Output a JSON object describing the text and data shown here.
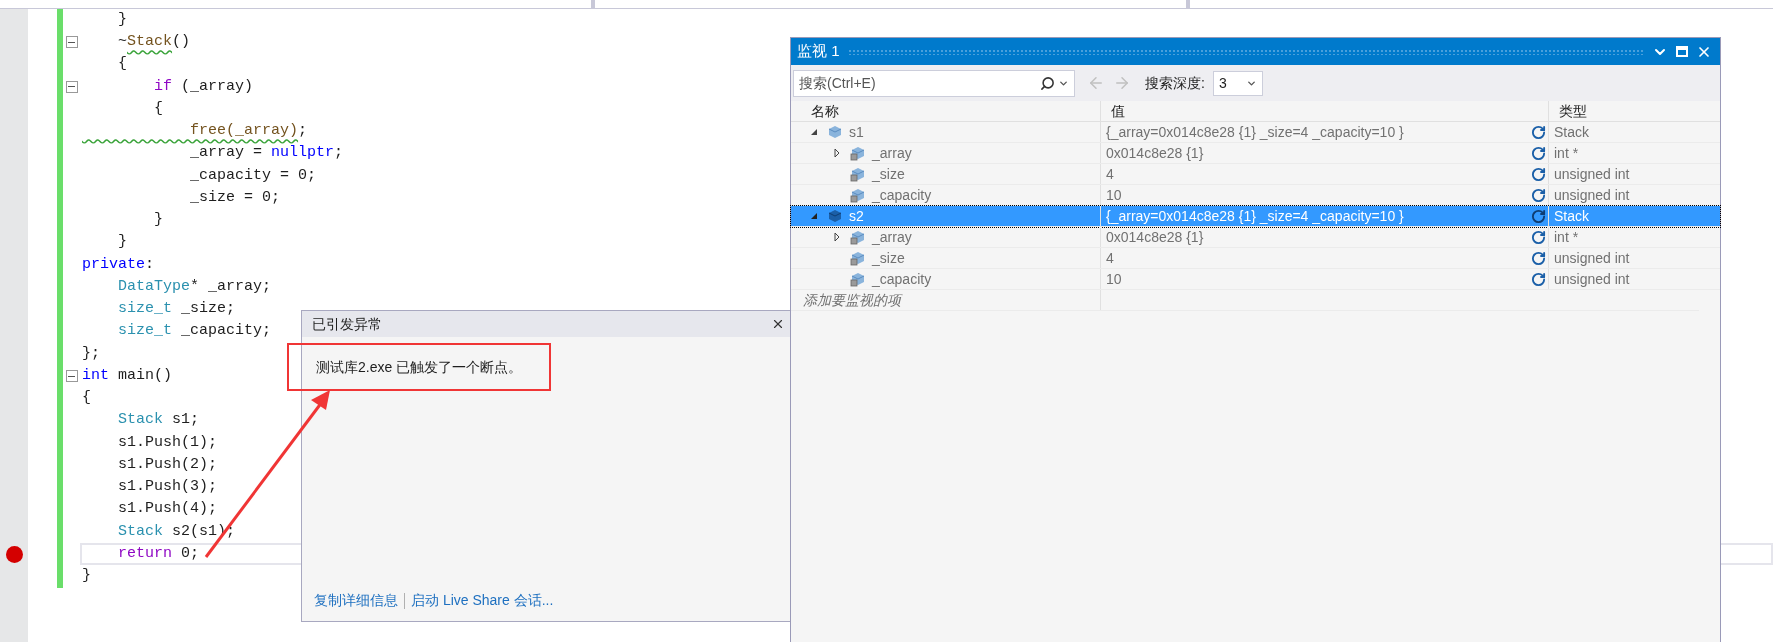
{
  "code_editor": {
    "lines": [
      {
        "fold_toggle": false,
        "breakpoint": false,
        "current": false,
        "tokens": [
          {
            "text": "    }",
            "kind": "plain"
          }
        ]
      },
      {
        "fold_toggle": true,
        "breakpoint": false,
        "current": false,
        "tokens": [
          {
            "text": "    ~",
            "kind": "plain"
          },
          {
            "text": "Stack",
            "kind": "function",
            "squiggle": true
          },
          {
            "text": "()",
            "kind": "plain"
          }
        ]
      },
      {
        "fold_toggle": false,
        "breakpoint": false,
        "current": false,
        "tokens": [
          {
            "text": "    {",
            "kind": "plain"
          }
        ]
      },
      {
        "fold_toggle": true,
        "breakpoint": false,
        "current": false,
        "tokens": [
          {
            "text": "        if",
            "kind": "control"
          },
          {
            "text": " (_array)",
            "kind": "plain"
          }
        ]
      },
      {
        "fold_toggle": false,
        "breakpoint": false,
        "current": false,
        "tokens": [
          {
            "text": "        {",
            "kind": "plain"
          }
        ]
      },
      {
        "fold_toggle": false,
        "breakpoint": false,
        "current": false,
        "tokens": [
          {
            "text": "            free(_array)",
            "kind": "function",
            "squiggle": true
          },
          {
            "text": ";",
            "kind": "plain"
          }
        ]
      },
      {
        "fold_toggle": false,
        "breakpoint": false,
        "current": false,
        "tokens": [
          {
            "text": "            _array = ",
            "kind": "plain"
          },
          {
            "text": "nullptr",
            "kind": "keyword"
          },
          {
            "text": ";",
            "kind": "plain"
          }
        ]
      },
      {
        "fold_toggle": false,
        "breakpoint": false,
        "current": false,
        "tokens": [
          {
            "text": "            _capacity = 0;",
            "kind": "plain"
          }
        ]
      },
      {
        "fold_toggle": false,
        "breakpoint": false,
        "current": false,
        "tokens": [
          {
            "text": "            _size = 0;",
            "kind": "plain"
          }
        ]
      },
      {
        "fold_toggle": false,
        "breakpoint": false,
        "current": false,
        "tokens": [
          {
            "text": "        }",
            "kind": "plain"
          }
        ]
      },
      {
        "fold_toggle": false,
        "breakpoint": false,
        "current": false,
        "tokens": [
          {
            "text": "    }",
            "kind": "plain"
          }
        ]
      },
      {
        "fold_toggle": false,
        "breakpoint": false,
        "current": false,
        "tokens": [
          {
            "text": "private",
            "kind": "keyword"
          },
          {
            "text": ":",
            "kind": "plain"
          }
        ]
      },
      {
        "fold_toggle": false,
        "breakpoint": false,
        "current": false,
        "tokens": [
          {
            "text": "    DataType",
            "kind": "type"
          },
          {
            "text": "* _array;",
            "kind": "plain"
          }
        ]
      },
      {
        "fold_toggle": false,
        "breakpoint": false,
        "current": false,
        "tokens": [
          {
            "text": "    size_t",
            "kind": "type"
          },
          {
            "text": " _size;",
            "kind": "plain"
          }
        ]
      },
      {
        "fold_toggle": false,
        "breakpoint": false,
        "current": false,
        "tokens": [
          {
            "text": "    size_t",
            "kind": "type"
          },
          {
            "text": " _capacity;",
            "kind": "plain"
          }
        ]
      },
      {
        "fold_toggle": false,
        "breakpoint": false,
        "current": false,
        "tokens": [
          {
            "text": "};",
            "kind": "plain"
          }
        ]
      },
      {
        "fold_toggle": true,
        "breakpoint": false,
        "current": false,
        "tokens": [
          {
            "text": "int",
            "kind": "keyword"
          },
          {
            "text": " main()",
            "kind": "plain"
          }
        ]
      },
      {
        "fold_toggle": false,
        "breakpoint": false,
        "current": false,
        "tokens": [
          {
            "text": "{",
            "kind": "plain"
          }
        ]
      },
      {
        "fold_toggle": false,
        "breakpoint": false,
        "current": false,
        "tokens": [
          {
            "text": "    Stack",
            "kind": "type"
          },
          {
            "text": " s1;",
            "kind": "plain"
          }
        ]
      },
      {
        "fold_toggle": false,
        "breakpoint": false,
        "current": false,
        "tokens": [
          {
            "text": "    s1.Push(1);",
            "kind": "plain"
          }
        ]
      },
      {
        "fold_toggle": false,
        "breakpoint": false,
        "current": false,
        "tokens": [
          {
            "text": "    s1.Push(2);",
            "kind": "plain"
          }
        ]
      },
      {
        "fold_toggle": false,
        "breakpoint": false,
        "current": false,
        "tokens": [
          {
            "text": "    s1.Push(3);",
            "kind": "plain"
          }
        ]
      },
      {
        "fold_toggle": false,
        "breakpoint": false,
        "current": false,
        "tokens": [
          {
            "text": "    s1.Push(4);",
            "kind": "plain"
          }
        ]
      },
      {
        "fold_toggle": false,
        "breakpoint": false,
        "current": false,
        "tokens": [
          {
            "text": "    Stack",
            "kind": "type"
          },
          {
            "text": " s2(s1);",
            "kind": "plain"
          }
        ]
      },
      {
        "fold_toggle": false,
        "breakpoint": true,
        "current": true,
        "tokens": [
          {
            "text": "    return",
            "kind": "control"
          },
          {
            "text": " 0;",
            "kind": "plain"
          }
        ]
      },
      {
        "fold_toggle": false,
        "breakpoint": false,
        "current": false,
        "tokens": [
          {
            "text": "}",
            "kind": "plain"
          }
        ]
      }
    ]
  },
  "exception_popup": {
    "title": "已引发异常",
    "message": "测试库2.exe 已触发了一个断点。",
    "links": [
      "复制详细信息",
      "启动 Live Share 会话..."
    ]
  },
  "watch_window": {
    "title": "监视 1",
    "search": {
      "placeholder": "搜索(Ctrl+E)"
    },
    "depth_label": "搜索深度:",
    "depth_value": "3",
    "columns": [
      "名称",
      "值",
      "类型"
    ],
    "rows": [
      {
        "name": "s1",
        "value": "{_array=0x014c8e28 {1} _size=4 _capacity=10 }",
        "type": "Stack",
        "expanded": true,
        "selected": false,
        "children": [
          {
            "name": "_array",
            "value": "0x014c8e28 {1}",
            "type": "int *",
            "expanded": false,
            "selected": false
          },
          {
            "name": "_size",
            "value": "4",
            "type": "unsigned int",
            "selected": false
          },
          {
            "name": "_capacity",
            "value": "10",
            "type": "unsigned int",
            "selected": false
          }
        ]
      },
      {
        "name": "s2",
        "value": "{_array=0x014c8e28 {1} _size=4 _capacity=10 }",
        "type": "Stack",
        "expanded": true,
        "selected": true,
        "children": [
          {
            "name": "_array",
            "value": "0x014c8e28 {1}",
            "type": "int *",
            "expanded": false,
            "selected": false
          },
          {
            "name": "_size",
            "value": "4",
            "type": "unsigned int",
            "selected": false
          },
          {
            "name": "_capacity",
            "value": "10",
            "type": "unsigned int",
            "selected": false
          }
        ]
      }
    ],
    "add_item_placeholder": "添加要监视的项"
  }
}
